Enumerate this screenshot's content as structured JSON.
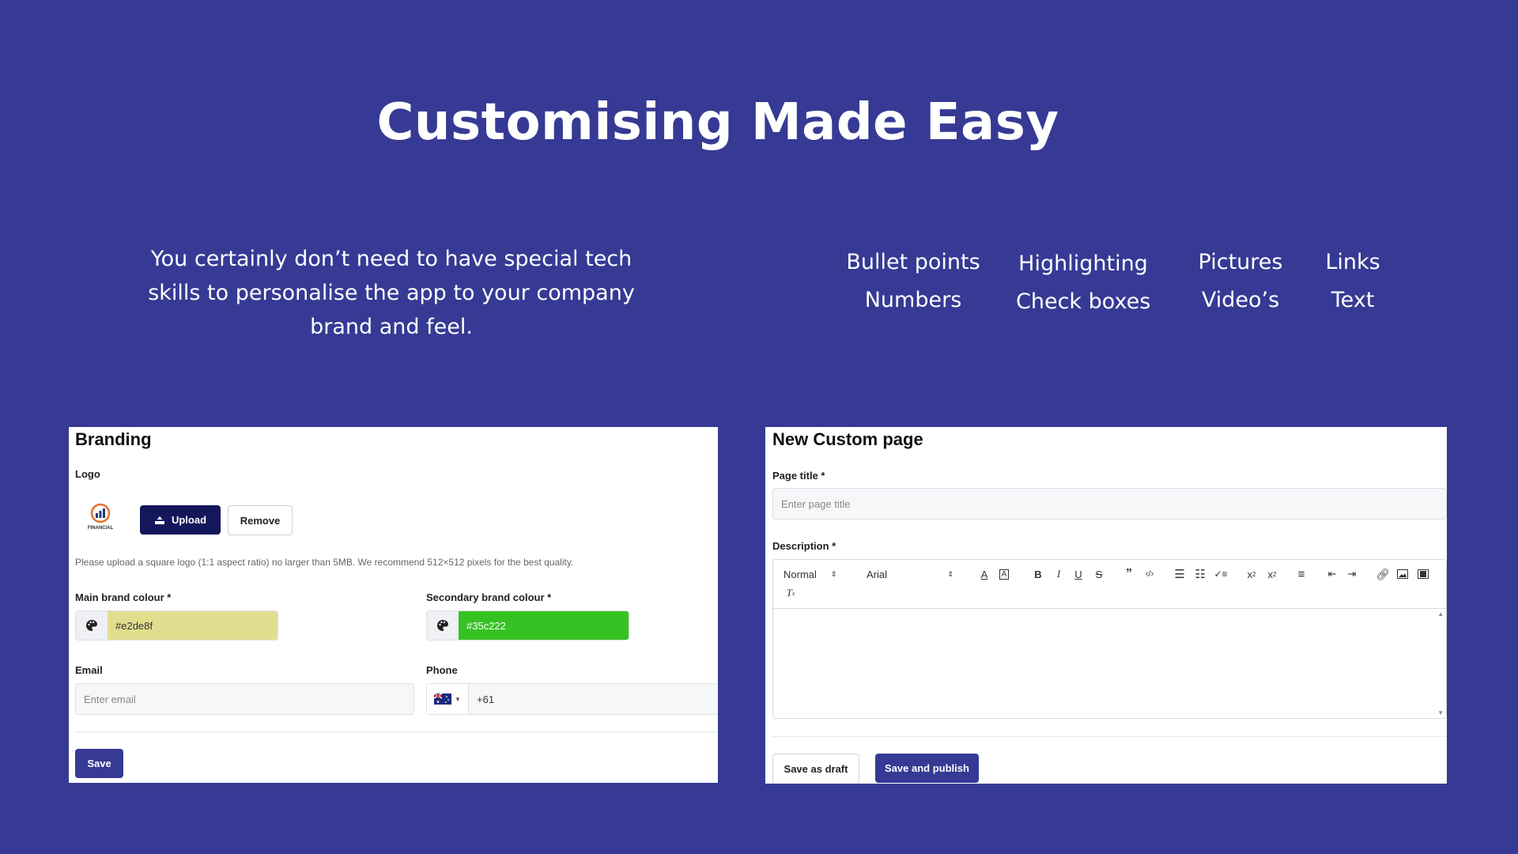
{
  "hero": {
    "title": "Customising Made Easy",
    "intro_line1": "You certainly don’t need to have special tech",
    "intro_line2": "skills to personalise the app to your company",
    "intro_line3": "brand and feel."
  },
  "features": [
    "Bullet points",
    "Highlighting",
    "Pictures",
    "Links",
    "Numbers",
    "Check boxes",
    "Video’s",
    "Text"
  ],
  "branding": {
    "title": "Branding",
    "logo_label": "Logo",
    "logo_text": "FINANCIAL",
    "upload_label": "Upload",
    "remove_label": "Remove",
    "hint": "Please upload a square logo (1:1 aspect ratio) no larger than 5MB. We recommend 512×512 pixels for the best quality.",
    "main_colour_label": "Main brand colour *",
    "main_colour_value": "#e2de8f",
    "secondary_colour_label": "Secondary brand colour *",
    "secondary_colour_value": "#35c222",
    "email_label": "Email",
    "email_placeholder": "Enter email",
    "phone_label": "Phone",
    "phone_value": "+61",
    "save_label": "Save"
  },
  "custom_page": {
    "title": "New Custom page",
    "page_title_label": "Page title *",
    "page_title_placeholder": "Enter page title",
    "description_label": "Description *",
    "toolbar": {
      "style_value": "Normal",
      "font_value": "Arial",
      "icons": [
        "text-color-icon",
        "background-color-icon",
        "bold-icon",
        "italic-icon",
        "underline-icon",
        "strikethrough-icon",
        "blockquote-icon",
        "code-icon",
        "ordered-list-icon",
        "bullet-list-icon",
        "check-list-icon",
        "subscript-icon",
        "superscript-icon",
        "align-icon",
        "outdent-icon",
        "indent-icon",
        "link-icon",
        "image-icon",
        "video-icon",
        "clear-format-icon"
      ]
    },
    "save_draft_label": "Save as draft",
    "publish_label": "Save and publish"
  },
  "colors": {
    "background": "#363a94",
    "dark_button": "#14175a",
    "primary": "#363a94"
  }
}
